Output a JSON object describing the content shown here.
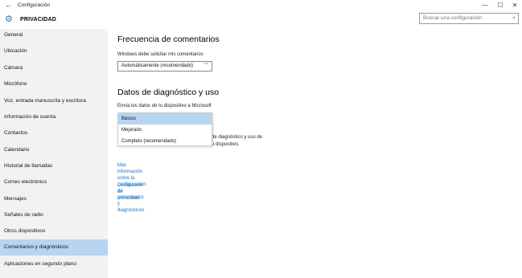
{
  "window": {
    "title": "Configuración",
    "back_glyph": "←",
    "controls": {
      "minimize": "—",
      "maximize": "☐",
      "close": "✕"
    }
  },
  "header": {
    "section_title": "PRIVACIDAD",
    "icon": "gear-icon",
    "search_placeholder": "Buscar una configuración"
  },
  "sidebar": {
    "items": [
      {
        "label": "General"
      },
      {
        "label": "Ubicación"
      },
      {
        "label": "Cámara"
      },
      {
        "label": "Micrófono"
      },
      {
        "label": "Voz, entrada manuscrita y escritura"
      },
      {
        "label": "Información de cuenta"
      },
      {
        "label": "Contactos"
      },
      {
        "label": "Calendario"
      },
      {
        "label": "Historial de llamadas"
      },
      {
        "label": "Correo electrónico"
      },
      {
        "label": "Mensajes"
      },
      {
        "label": "Señales de radio"
      },
      {
        "label": "Otros dispositivos"
      },
      {
        "label": "Comentarios y diagnósticos",
        "selected": true
      },
      {
        "label": "Aplicaciones en segundo plano"
      }
    ]
  },
  "main": {
    "feedback": {
      "title": "Frecuencia de comentarios",
      "label": "Windows debe solicitar mis comentarios",
      "value": "Automáticamente (recomendado)"
    },
    "diagnostics": {
      "title": "Datos de diagnóstico y uso",
      "label": "Envía los datos de tu dispositivo a Microsoft",
      "options": [
        "Básico",
        "Mejorado",
        "Completo (recomendado)"
      ],
      "selected_option": "Básico",
      "hidden_text_line1": "de diagnóstico y uso de",
      "hidden_text_line2": "u dispositivo."
    },
    "links": {
      "more_info_line1": "Más información sobre la configuración de comentarios y",
      "more_info_line2": "diagnósticos",
      "privacy": "Declaración de privacidad"
    }
  },
  "colors": {
    "accent": "#1979ca",
    "selection": "#b7d5f3",
    "sidebar_bg": "#f2f2f2"
  }
}
